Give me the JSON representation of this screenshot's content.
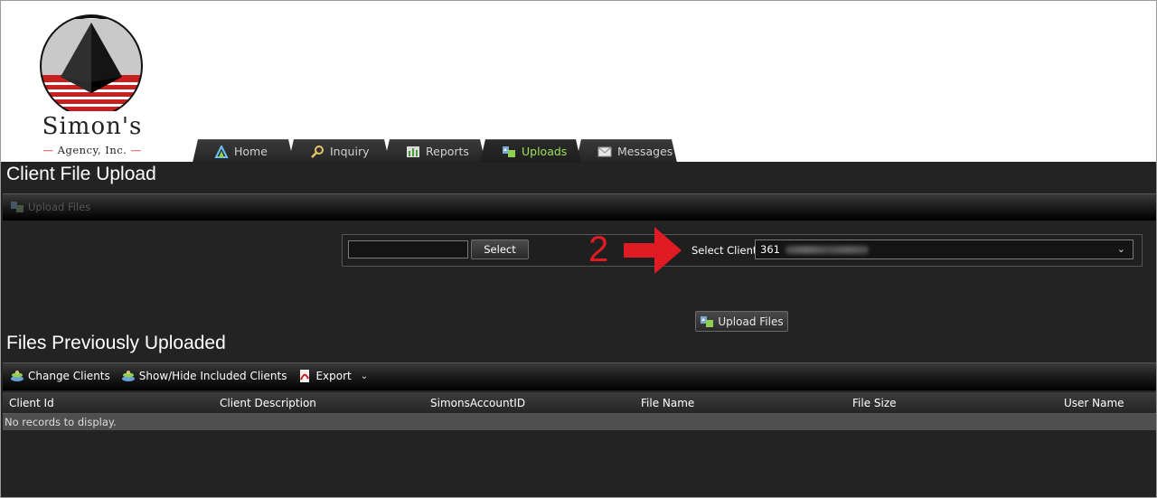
{
  "logo": {
    "name": "Simon's",
    "subtitle": "Agency, Inc."
  },
  "tabs": [
    {
      "label": "Home",
      "icon": "home-icon"
    },
    {
      "label": "Inquiry",
      "icon": "magnifier-icon"
    },
    {
      "label": "Reports",
      "icon": "bar-chart-icon"
    },
    {
      "label": "Uploads",
      "icon": "upload-icon",
      "active": true
    },
    {
      "label": "Messages",
      "icon": "envelope-icon"
    }
  ],
  "upload_section": {
    "title": "Client File Upload",
    "toolbar_label": "Upload Files",
    "client_input_value": "",
    "select_button": "Select",
    "step_number": "2",
    "select_client_label": "Select Client:",
    "selected_client": "361",
    "upload_button": "Upload Files"
  },
  "files_section": {
    "title": "Files Previously Uploaded",
    "toolbar": {
      "change_clients": "Change Clients",
      "show_hide": "Show/Hide Included Clients",
      "export": "Export"
    },
    "columns": [
      "Client Id",
      "Client Description",
      "SimonsAccountID",
      "File Name",
      "File Size",
      "User Name"
    ],
    "empty_message": "No records to display."
  },
  "colors": {
    "accent_green": "#9ee25a",
    "arrow_red": "#e01b24",
    "logo_red": "#c8201e",
    "background_dark": "#232323"
  }
}
